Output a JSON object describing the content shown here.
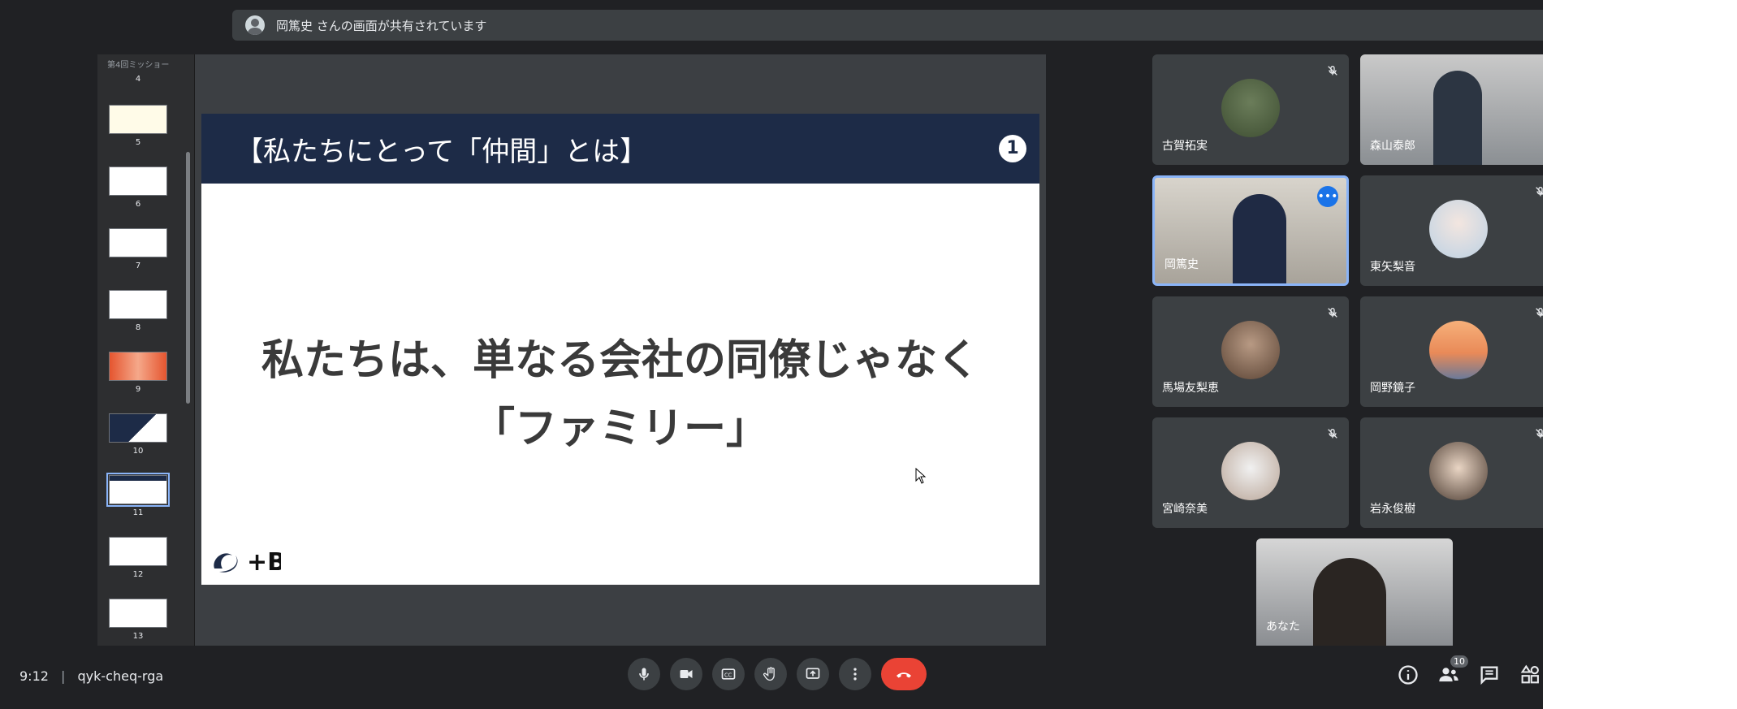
{
  "banner": {
    "text": "岡篤史 さんの画面が共有されています"
  },
  "thumbnails": {
    "header": "第4回ミッショー",
    "items": [
      {
        "num": "4"
      },
      {
        "num": "5"
      },
      {
        "num": "6"
      },
      {
        "num": "7"
      },
      {
        "num": "8"
      },
      {
        "num": "9"
      },
      {
        "num": "10"
      },
      {
        "num": "11"
      },
      {
        "num": "12"
      },
      {
        "num": "13"
      }
    ],
    "active": "11"
  },
  "slide": {
    "title": "【私たちにとって「仲間」とは】",
    "number": "1",
    "line1": "私たちは、単なる会社の同僚じゃなく",
    "line2": "「ファミリー」",
    "logo": "+B"
  },
  "participants": [
    {
      "name": "古賀拓実",
      "muted": true
    },
    {
      "name": "森山泰郎",
      "muted": false
    },
    {
      "name": "岡篤史",
      "muted": false,
      "speaking": true
    },
    {
      "name": "東矢梨音",
      "muted": true
    },
    {
      "name": "馬場友梨恵",
      "muted": true
    },
    {
      "name": "岡野鏡子",
      "muted": true
    },
    {
      "name": "宮崎奈美",
      "muted": true
    },
    {
      "name": "岩永俊樹",
      "muted": true
    },
    {
      "name": "あなた",
      "muted": false
    }
  ],
  "bottom": {
    "time": "9:12",
    "meeting_code": "qyk-cheq-rga",
    "people_count": "10"
  },
  "colors": {
    "hangup": "#ea4335",
    "accent": "#8ab4f8",
    "background": "#202124"
  },
  "icons": [
    "mic-icon",
    "camera-icon",
    "captions-icon",
    "raise-hand-icon",
    "present-icon",
    "more-icon",
    "hangup-icon",
    "info-icon",
    "people-icon",
    "chat-icon",
    "activities-icon"
  ]
}
